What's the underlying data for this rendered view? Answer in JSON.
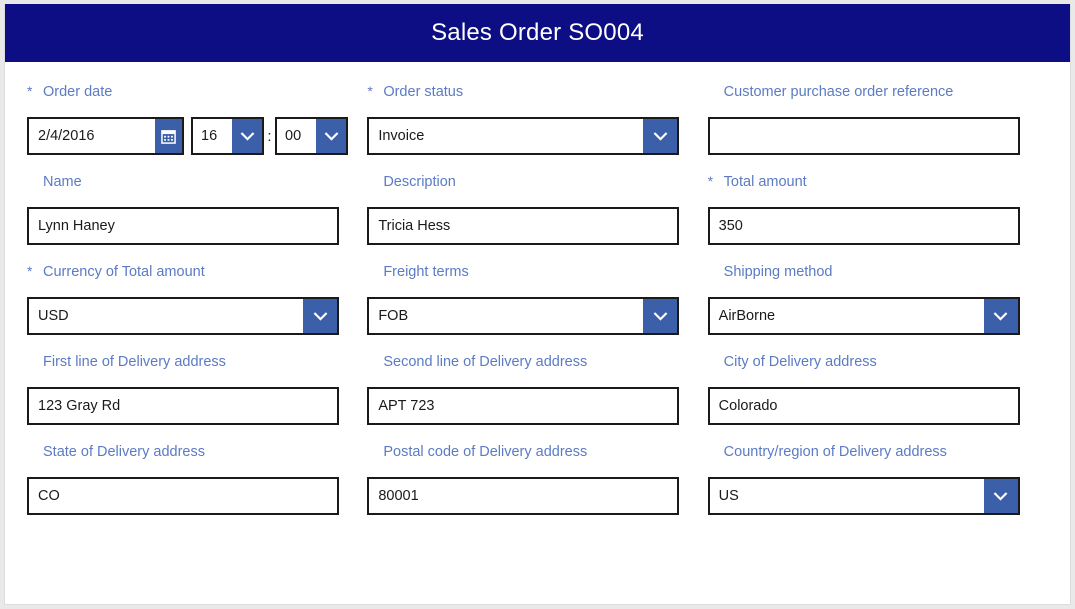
{
  "header": {
    "title": "Sales Order SO004",
    "background_color": "#0d0d84",
    "text_color": "#ffffff"
  },
  "theme": {
    "label_color": "#5b7bc4",
    "accent_button_color": "#3b5fa8",
    "input_border_color": "#1a1a1a",
    "page_background": "#e9e9e9",
    "panel_background": "#ffffff"
  },
  "form": {
    "required_marker": "*",
    "time_separator": ":",
    "rows": [
      {
        "fields": [
          {
            "label": "Order date",
            "required": true,
            "type": "datetime",
            "date_value": "2/4/2016",
            "hour_value": "16",
            "minute_value": "00",
            "calendar_icon": "calendar-icon"
          },
          {
            "label": "Order status",
            "required": true,
            "type": "dropdown",
            "value": "Invoice"
          },
          {
            "label": "Customer purchase order reference",
            "required": false,
            "type": "text",
            "value": "",
            "placeholder": ""
          }
        ]
      },
      {
        "fields": [
          {
            "label": "Name",
            "required": false,
            "type": "text",
            "value": "Lynn Haney",
            "placeholder": ""
          },
          {
            "label": "Description",
            "required": false,
            "type": "text",
            "value": "Tricia Hess",
            "placeholder": ""
          },
          {
            "label": "Total amount",
            "required": true,
            "type": "text",
            "value": "350",
            "placeholder": ""
          }
        ]
      },
      {
        "fields": [
          {
            "label": "Currency of Total amount",
            "required": true,
            "type": "dropdown",
            "value": "USD"
          },
          {
            "label": "Freight terms",
            "required": false,
            "type": "dropdown",
            "value": "FOB"
          },
          {
            "label": "Shipping method",
            "required": false,
            "type": "dropdown",
            "value": "AirBorne"
          }
        ]
      },
      {
        "fields": [
          {
            "label": "First line of Delivery address",
            "required": false,
            "type": "text",
            "value": "123 Gray Rd",
            "placeholder": ""
          },
          {
            "label": "Second line of Delivery address",
            "required": false,
            "type": "text",
            "value": "APT 723",
            "placeholder": ""
          },
          {
            "label": "City of Delivery address",
            "required": false,
            "type": "text",
            "value": "Colorado",
            "placeholder": ""
          }
        ]
      },
      {
        "fields": [
          {
            "label": "State of Delivery address",
            "required": false,
            "type": "text",
            "value": "CO",
            "placeholder": ""
          },
          {
            "label": "Postal code of Delivery address",
            "required": false,
            "type": "text",
            "value": "80001",
            "placeholder": ""
          },
          {
            "label": "Country/region of Delivery address",
            "required": false,
            "type": "dropdown",
            "value": "US"
          }
        ]
      }
    ]
  }
}
